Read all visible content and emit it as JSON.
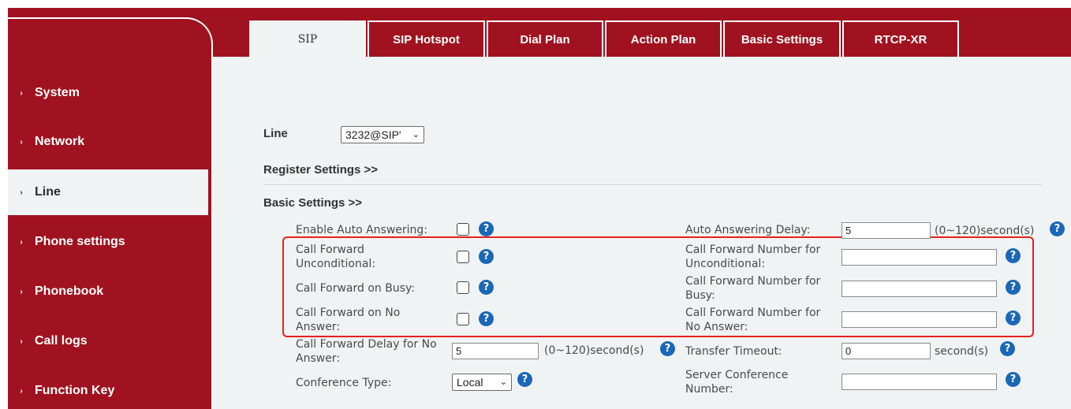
{
  "tabs": [
    {
      "label": "SIP"
    },
    {
      "label": "SIP Hotspot"
    },
    {
      "label": "Dial Plan"
    },
    {
      "label": "Action Plan"
    },
    {
      "label": "Basic Settings"
    },
    {
      "label": "RTCP-XR"
    }
  ],
  "sidebar": {
    "items": [
      {
        "label": "System"
      },
      {
        "label": "Network"
      },
      {
        "label": "Line"
      },
      {
        "label": "Phone settings"
      },
      {
        "label": "Phonebook"
      },
      {
        "label": "Call logs"
      },
      {
        "label": "Function Key"
      }
    ]
  },
  "line": {
    "label": "Line",
    "value": "3232@SIP'"
  },
  "sections": {
    "register": "Register Settings >>",
    "basic": "Basic Settings >>"
  },
  "form": {
    "enable_auto_answering": "Enable Auto Answering:",
    "cf_unconditional_1": "Call Forward",
    "cf_unconditional_2": "Unconditional:",
    "cf_busy": "Call Forward on Busy:",
    "cf_no_answer_1": "Call Forward on No",
    "cf_no_answer_2": "Answer:",
    "cf_delay_1": "Call Forward Delay for No",
    "cf_delay_2": "Answer:",
    "cf_delay_value": "5",
    "cf_delay_unit": "(0~120)second(s)",
    "conference_type": "Conference Type:",
    "conference_type_value": "Local",
    "auto_answering_delay": "Auto Answering Delay:",
    "auto_answering_delay_value": "5",
    "auto_answering_delay_unit": "(0~120)second(s)",
    "cfn_unconditional_1": "Call Forward Number for",
    "cfn_unconditional_2": "Unconditional:",
    "cfn_busy_1": "Call Forward Number for",
    "cfn_busy_2": "Busy:",
    "cfn_no_answer_1": "Call Forward Number for",
    "cfn_no_answer_2": "No Answer:",
    "transfer_timeout": "Transfer Timeout:",
    "transfer_timeout_value": "0",
    "transfer_timeout_unit": "second(s)",
    "server_conference_1": "Server Conference",
    "server_conference_2": "Number:"
  },
  "icons": {
    "help": "?",
    "chevron": "›",
    "dropdown": "⌄"
  },
  "colors": {
    "brand": "#a01220",
    "content_bg": "#f0f3f4",
    "help_icon": "#1a67b8",
    "highlight": "#e8211a"
  }
}
